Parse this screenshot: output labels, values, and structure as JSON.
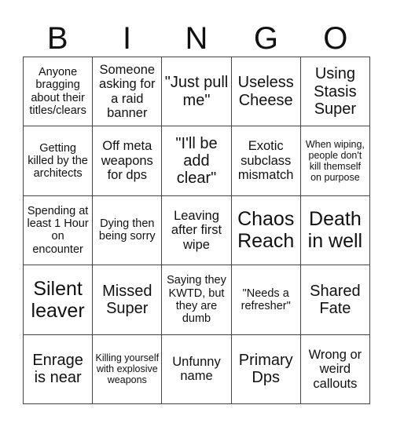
{
  "header": {
    "letters": [
      "B",
      "I",
      "N",
      "G",
      "O"
    ]
  },
  "grid": {
    "rows": [
      [
        {
          "text": "Anyone bragging about their titles/clears",
          "size": "s-sm"
        },
        {
          "text": "Someone asking for a raid banner",
          "size": "s-md"
        },
        {
          "text": "\"Just pull me\"",
          "size": "s-lg"
        },
        {
          "text": "Useless Cheese",
          "size": "s-lg"
        },
        {
          "text": "Using Stasis Super",
          "size": "s-lg"
        }
      ],
      [
        {
          "text": "Getting killed by the architects",
          "size": "s-sm"
        },
        {
          "text": "Off meta weapons for dps",
          "size": "s-md"
        },
        {
          "text": "\"I'll be add clear\"",
          "size": "s-lg"
        },
        {
          "text": "Exotic subclass mismatch",
          "size": "s-md"
        },
        {
          "text": "When wiping, people don't kill themself on purpose",
          "size": "s-xs"
        }
      ],
      [
        {
          "text": "Spending at least 1 Hour on encounter",
          "size": "s-sm"
        },
        {
          "text": "Dying then being sorry",
          "size": "s-sm"
        },
        {
          "text": "Leaving after first wipe",
          "size": "s-md"
        },
        {
          "text": "Chaos Reach",
          "size": "s-xl"
        },
        {
          "text": "Death in well",
          "size": "s-xl"
        }
      ],
      [
        {
          "text": "Silent leaver",
          "size": "s-xl"
        },
        {
          "text": "Missed Super",
          "size": "s-lg"
        },
        {
          "text": "Saying they KWTD, but they are dumb",
          "size": "s-sm"
        },
        {
          "text": "\"Needs a refresher\"",
          "size": "s-sm"
        },
        {
          "text": "Shared Fate",
          "size": "s-lg"
        }
      ],
      [
        {
          "text": "Enrage is near",
          "size": "s-lg"
        },
        {
          "text": "Killing yourself with explosive weapons",
          "size": "s-xs"
        },
        {
          "text": "Unfunny name",
          "size": "s-md"
        },
        {
          "text": "Primary Dps",
          "size": "s-lg"
        },
        {
          "text": "Wrong or weird callouts",
          "size": "s-md"
        }
      ]
    ]
  }
}
